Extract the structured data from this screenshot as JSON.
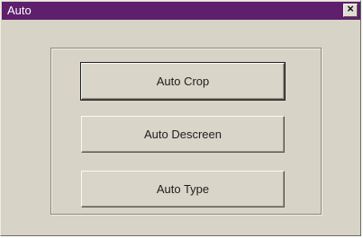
{
  "window": {
    "title": "Auto",
    "close_glyph": "×"
  },
  "buttons": {
    "auto_crop": "Auto Crop",
    "auto_descreen": "Auto Descreen",
    "auto_type": "Auto Type"
  },
  "colors": {
    "titlebar": "#5e1f6c",
    "face": "#d7d3c6"
  }
}
